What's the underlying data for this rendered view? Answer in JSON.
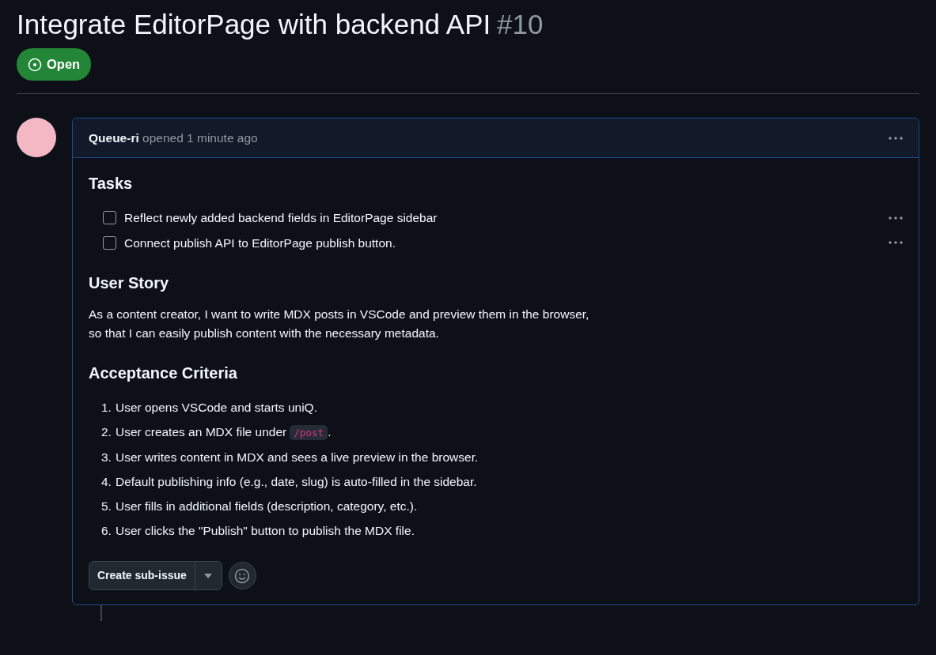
{
  "issue": {
    "title": "Integrate EditorPage with backend API",
    "number": "#10",
    "state": "Open"
  },
  "comment": {
    "author": "Queue-ri",
    "action": "opened 1 minute ago",
    "sections": [
      {
        "kind": "tasks",
        "heading": "Tasks",
        "items": [
          {
            "text": "Reflect newly added backend fields in EditorPage sidebar",
            "checked": false
          },
          {
            "text": "Connect publish API to EditorPage publish button.",
            "checked": false
          }
        ]
      },
      {
        "kind": "paragraph",
        "heading": "User Story",
        "lines": [
          "As a content creator, I want to write MDX posts in VSCode and preview them in the browser,",
          "so that I can easily publish content with the necessary metadata."
        ]
      },
      {
        "kind": "ordered",
        "heading": "Acceptance Criteria",
        "items": [
          {
            "number": "1.",
            "text": "User opens VSCode and starts uniQ."
          },
          {
            "number": "2.",
            "text": "User creates an MDX file under ",
            "code": "/post",
            "after": "."
          },
          {
            "number": "3.",
            "text": "User writes content in MDX and sees a live preview in the browser."
          },
          {
            "number": "4.",
            "text": "Default publishing info (e.g., date, slug) is auto-filled in the sidebar."
          },
          {
            "number": "5.",
            "text": "User fills in additional fields (description, category, etc.)."
          },
          {
            "number": "6.",
            "text": "User clicks the \"Publish\" button to publish the MDX file."
          }
        ]
      }
    ],
    "button": "Create sub-issue"
  }
}
